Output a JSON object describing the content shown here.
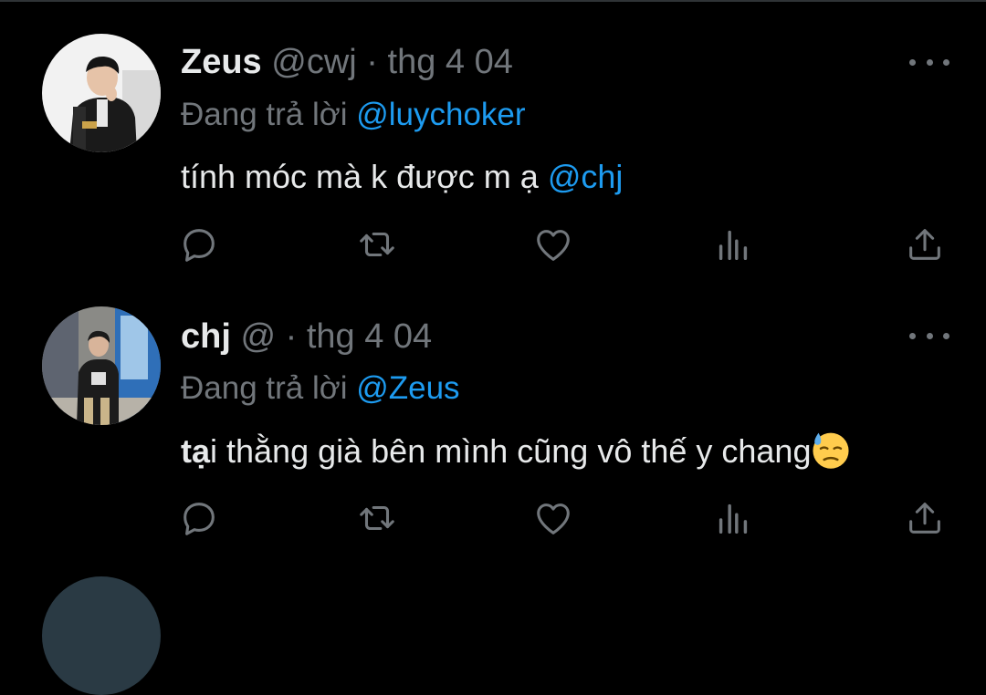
{
  "tweets": [
    {
      "name": "Zeus",
      "handle": "@cwj",
      "separator": "·",
      "date": "thg 4 04",
      "reply_prefix": "Đang trả lời",
      "reply_to": "@luychoker",
      "text_main": "tính móc mà k được m ạ ",
      "text_mention": "@chj",
      "icons": [
        "reply-icon",
        "retweet-icon",
        "like-icon",
        "views-icon",
        "share-icon"
      ]
    },
    {
      "name": "chj",
      "handle": "@",
      "separator": "·",
      "date": "thg 4 04",
      "reply_prefix": "Đang trả lời",
      "reply_to": "@Zeus",
      "text_bold": "tạ",
      "text_main": "i thằng già bên mình cũng vô thế y chang",
      "emoji": "downcast-face-with-sweat",
      "icons": [
        "reply-icon",
        "retweet-icon",
        "like-icon",
        "views-icon",
        "share-icon"
      ]
    }
  ],
  "colors": {
    "background": "#000000",
    "text": "#e7e9ea",
    "secondary": "#71767b",
    "link": "#1d9bf0"
  }
}
